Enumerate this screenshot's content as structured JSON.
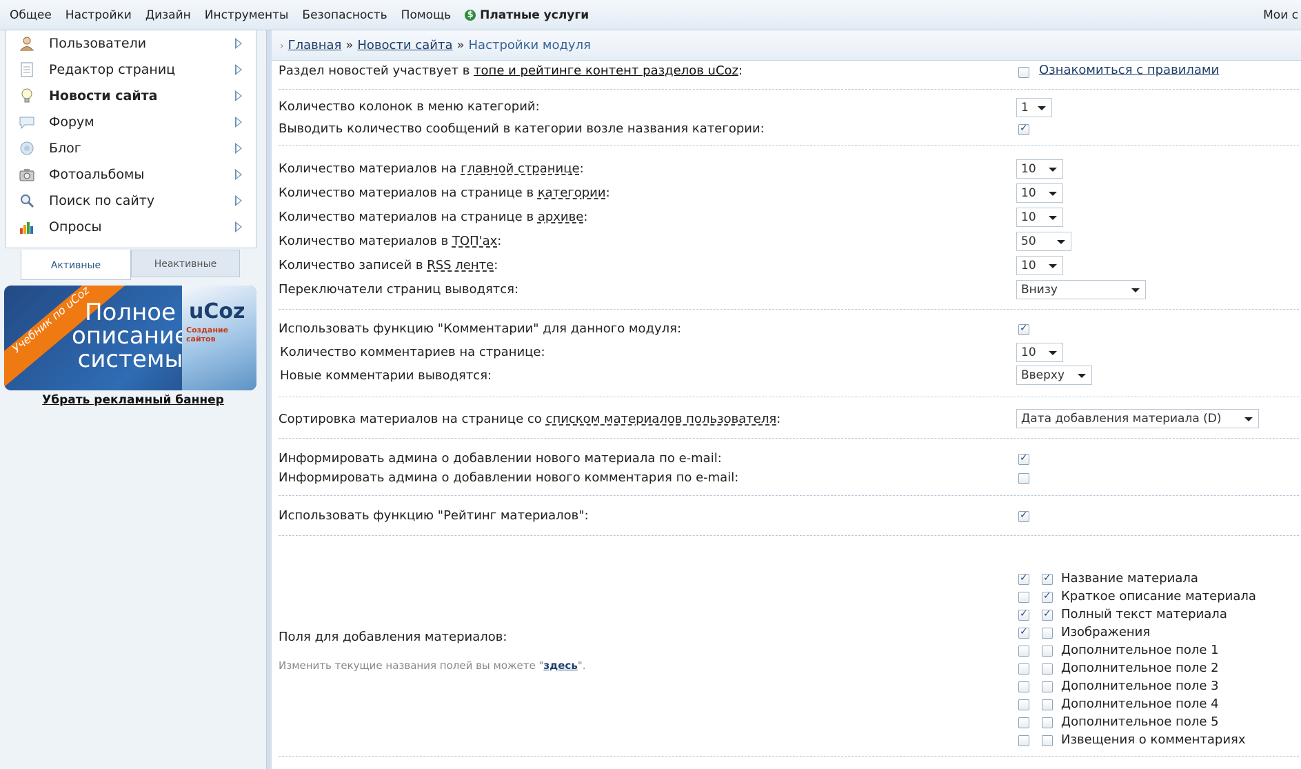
{
  "top_menu": {
    "items": [
      "Общее",
      "Настройки",
      "Дизайн",
      "Инструменты",
      "Безопасность",
      "Помощь"
    ],
    "paid_label": "Платные услуги",
    "my_sites": "Мои с"
  },
  "sidebar": {
    "modules": [
      {
        "label": "Пользователи",
        "icon": "user-icon"
      },
      {
        "label": "Редактор страниц",
        "icon": "page-icon"
      },
      {
        "label": "Новости сайта",
        "icon": "bulb-icon"
      },
      {
        "label": "Форум",
        "icon": "chat-icon"
      },
      {
        "label": "Блог",
        "icon": "blog-icon"
      },
      {
        "label": "Фотоальбомы",
        "icon": "camera-icon"
      },
      {
        "label": "Поиск по сайту",
        "icon": "search-icon"
      },
      {
        "label": "Опросы",
        "icon": "chart-icon"
      }
    ],
    "tabs": {
      "active": "Активные",
      "inactive": "Неактивные"
    },
    "banner": {
      "ribbon": "Учебник по uCoz",
      "headline": "Полное описание системы",
      "logo": "uCoz",
      "logo_sub": "Создание сайтов"
    },
    "remove_banner": "Убрать рекламный баннер"
  },
  "breadcrumb": {
    "home": "Главная",
    "news": "Новости сайта",
    "current": "Настройки модуля",
    "separator": "»"
  },
  "settings": {
    "top_rating": {
      "prefix": "Раздел новостей участвует в ",
      "link": "топе и рейтинге контент разделов uCoz",
      "suffix": ":",
      "rules_link": "Ознакомиться с правилами",
      "checked": false
    },
    "cat_columns": {
      "label": "Количество колонок в меню категорий:",
      "value": "1"
    },
    "show_msg_count": {
      "label": "Выводить количество сообщений в категории возле названия категории:",
      "checked": true
    },
    "per_main": {
      "label_a": "Количество материалов на ",
      "label_u": "главной странице",
      "label_b": ":",
      "value": "10"
    },
    "per_cat": {
      "label_a": "Количество материалов на странице в ",
      "label_u": "категории",
      "label_b": ":",
      "value": "10"
    },
    "per_archive": {
      "label_a": "Количество материалов на странице в ",
      "label_u": "архиве",
      "label_b": ":",
      "value": "10"
    },
    "per_top": {
      "label_a": "Количество материалов в ",
      "label_u": "ТОП'ах",
      "label_b": ":",
      "value": "50"
    },
    "per_rss": {
      "label_a": "Количество записей в ",
      "label_u": "RSS ленте",
      "label_b": ":",
      "value": "10"
    },
    "pager_pos": {
      "label": "Переключатели страниц выводятся:",
      "value": "Внизу"
    },
    "use_comments": {
      "label": "Использовать функцию \"Комментарии\" для данного модуля:",
      "checked": true
    },
    "comments_per_page": {
      "label": "Количество комментариев на странице:",
      "value": "10"
    },
    "new_comments": {
      "label": "Новые комментарии выводятся:",
      "value": "Вверху"
    },
    "user_sort": {
      "label_a": "Сортировка материалов на странице со ",
      "label_u": "списком материалов пользователя",
      "label_b": ":",
      "value": "Дата добавления материала (D)"
    },
    "notify_material": {
      "label": "Информировать админа о добавлении нового материала по e-mail:",
      "checked": true
    },
    "notify_comment": {
      "label": "Информировать админа о добавлении нового комментария по e-mail:",
      "checked": false
    },
    "use_rating": {
      "label": "Использовать функцию \"Рейтинг материалов\":",
      "checked": true
    },
    "fields": {
      "label": "Поля для добавления материалов:",
      "hint_prefix": "Изменить текущие названия полей вы можете \"",
      "hint_link": "здесь",
      "hint_suffix": "\".",
      "items": [
        {
          "name": "Название материала",
          "a": true,
          "b": true
        },
        {
          "name": "Краткое описание материала",
          "a": false,
          "b": true
        },
        {
          "name": "Полный текст материала",
          "a": true,
          "b": true
        },
        {
          "name": "Изображения",
          "a": true,
          "b": false
        },
        {
          "name": "Дополнительное поле 1",
          "a": false,
          "b": false
        },
        {
          "name": "Дополнительное поле 2",
          "a": false,
          "b": false
        },
        {
          "name": "Дополнительное поле 3",
          "a": false,
          "b": false
        },
        {
          "name": "Дополнительное поле 4",
          "a": false,
          "b": false
        },
        {
          "name": "Дополнительное поле 5",
          "a": false,
          "b": false
        },
        {
          "name": "Извещения о комментариях",
          "a": false,
          "b": false
        }
      ]
    }
  }
}
